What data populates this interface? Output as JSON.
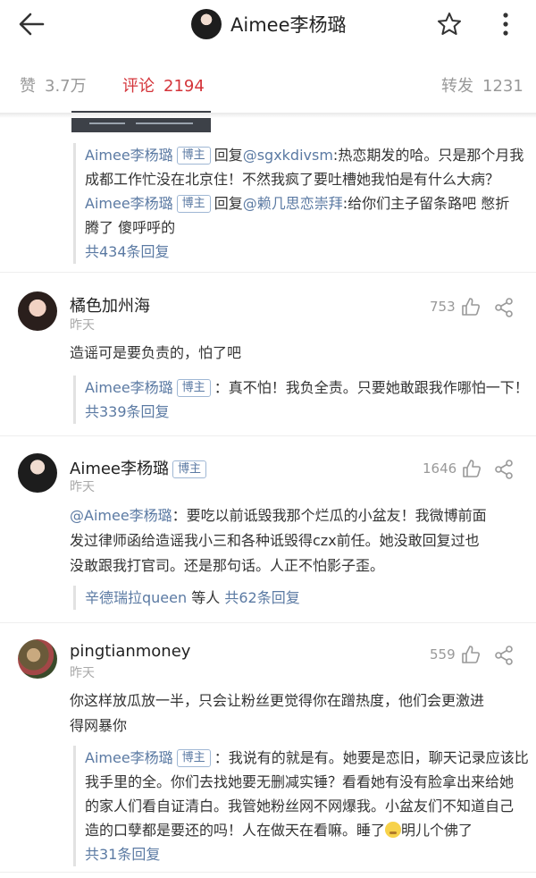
{
  "header": {
    "title": "Aimee李杨璐"
  },
  "stats": {
    "likes_label": "赞",
    "likes_value": "3.7万",
    "comments_label": "评论",
    "comments_value": "2194",
    "reposts_label": "转发",
    "reposts_value": "1231"
  },
  "thread0": {
    "replies": [
      {
        "author": "Aimee李杨璐",
        "tag": "博主",
        "reply_word": "回复",
        "target": "@sgxkdivsm",
        "line1": ":热恋期发的哈。只是那个月我",
        "line2": "成都工作忙没在北京住！不然我疯了要吐槽她我怕是有什么大病？"
      },
      {
        "author": "Aimee李杨璐",
        "tag": "博主",
        "reply_word": "回复",
        "target": "@赖几思恋崇拜",
        "line1": ":给你们主子留条路吧 憋折",
        "line2": "腾了 傻呼呼的"
      }
    ],
    "more": "共434条回复"
  },
  "comments": [
    {
      "name": "橘色加州海",
      "date": "昨天",
      "likes": "753",
      "text": "造谣可是要负责的，怕了吧",
      "reply_author": "Aimee李杨璐",
      "reply_tag": "博主",
      "reply_text": "：真不怕！我负全责。只要她敢跟我作哪怕一下！",
      "more": "共339条回复"
    },
    {
      "name": "Aimee李杨璐",
      "tag": "博主",
      "date": "昨天",
      "likes": "1646",
      "mention": "@Aimee李杨璐",
      "text1": "：要吃以前诋毁我那个烂瓜的小盆友！我微博前面",
      "text2": "发过律师函给造谣我小三和各种诋毁得czx前任。她没敢回复过也",
      "text3": "没敢跟我打官司。还是那句话。人正不怕影子歪。",
      "reply_names": "辛德瑞拉queen",
      "reply_etc": "等人",
      "more": "共62条回复"
    },
    {
      "name": "pingtianmoney",
      "date": "昨天",
      "likes": "559",
      "text1": "你这样放瓜放一半，只会让粉丝更觉得你在蹭热度，他们会更激进",
      "text2": "得网暴你",
      "reply_author": "Aimee李杨璐",
      "reply_tag": "博主",
      "reply_line1": "：我说有的就是有。她要是恋旧，聊天记录应该比",
      "reply_line2": "我手里的全。你们去找她要无删减实锤？看看她有没有脸拿出来给她",
      "reply_line3": "的家人们看自证清白。我管她粉丝网不网爆我。小盆友们不知道自己",
      "reply_line4a": "造的口孽都是要还的吗！人在做天在看嘛。睡了",
      "reply_line4b": "明儿个佛了",
      "more": "共31条回复"
    }
  ],
  "icons": {
    "back": "arrow-left-icon",
    "star": "star-outline-icon",
    "more": "vertical-dots-icon",
    "like": "thumb-up-icon",
    "share": "share-nodes-icon",
    "emoji": "sleepy-face-emoji"
  },
  "colors": {
    "accent_red": "#d4343a",
    "link_blue": "#5b7aa3",
    "muted_gray": "#999999"
  }
}
